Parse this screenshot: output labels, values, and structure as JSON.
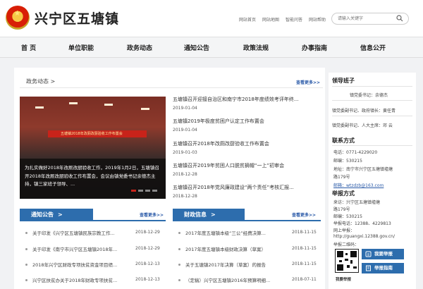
{
  "header": {
    "site_title": "兴宁区五塘镇",
    "top_links": [
      "网站首页",
      "网站地图",
      "智能问答",
      "网站帮助"
    ],
    "search_placeholder": "请输入关键字",
    "emblem_icon": "national-emblem-icon"
  },
  "nav": {
    "items": [
      "首 页",
      "单位职能",
      "政务动态",
      "通知公告",
      "政策法规",
      "办事指南",
      "信息公开"
    ]
  },
  "news": {
    "section_title": "政务动态 >",
    "more": "查看更多>>",
    "slider": {
      "banner_text": "五塘镇2018年改厕改厨验收工作布置会",
      "caption": "为扎实做好2018年改厕改厨验收工作，2019年1月2日，五塘镇召开2018年改厕改厨验收工作布置会，会议由镇党委书记余德杰主持，镇三家班子领导、...",
      "active_dot": 0,
      "dot_count": 4
    },
    "items": [
      {
        "title": "五塘镇召开迎接自治区和南宁市2018年度绩效考评年终...",
        "date": "2019-01-04"
      },
      {
        "title": "五塘镇2019年极度贫困户认定工作布置会",
        "date": "2019-01-04"
      },
      {
        "title": "五塘镇召开2018年改厕改厨验收工作布置会",
        "date": "2019-01-03"
      },
      {
        "title": "五塘镇召开2019年贫困人口脱贫摘帽“一上”初审会",
        "date": "2018-12-28"
      },
      {
        "title": "五塘镇召开2018年党风廉政建设“两个责任”考核汇报...",
        "date": "2018-12-28"
      }
    ]
  },
  "notice": {
    "title": "通知公告",
    "arrow": ">",
    "more": "查看更多>>",
    "items": [
      {
        "title": "关于印发《兴宁区五塘镇民族宗教工作...",
        "date": "2018-12-29"
      },
      {
        "title": "关于印发《南宁市兴宁区五塘镇2018年...",
        "date": "2018-12-29"
      },
      {
        "title": "2018年兴宁区财政专项扶贫资金项目绩...",
        "date": "2018-12-13"
      },
      {
        "title": "兴宁区扶贫办关于2018年财政专项扶贫...",
        "date": "2018-12-13"
      }
    ]
  },
  "finance": {
    "title": "财政信息",
    "arrow": ">",
    "more": "查看更多>>",
    "items": [
      {
        "title": "2017年度五塘镇本级“三公”经费决算...",
        "date": "2018-11-15"
      },
      {
        "title": "2017年度五塘镇本级财政决算（草案）",
        "date": "2018-11-15"
      },
      {
        "title": "关于五塘镇2017年决算（草案）的报告",
        "date": "2018-11-15"
      },
      {
        "title": "（定稿）兴宁区五塘镇2016年预算明细...",
        "date": "2018-07-11"
      }
    ]
  },
  "side": {
    "leaders_title": "领导班子",
    "leaders": [
      "镇党委书记：余德杰",
      "镇党委副书记、政府镇长：黄任青",
      "镇党委副书记、人大主席：邓 云"
    ],
    "contact_title": "联系方式",
    "contact": [
      "电话：0771-4229020",
      "邮编：530215",
      "地址：南宁市兴宁区五塘镇墟塘",
      "路179号",
      "邮箱：wtzdzb@163.com"
    ],
    "report_title": "举报方式",
    "report": [
      "来访：兴宁区五塘镇墟塘",
      "路179号",
      "邮编：530215",
      "举报电话：12388、4229813",
      "网上举报：",
      "http://guangxi.12388.gov.cn/",
      "举报二维码："
    ],
    "qr_caption": "我要举报",
    "buttons": [
      {
        "label": "我要举报",
        "icon": "report-icon"
      },
      {
        "label": "举报指南",
        "icon": "guide-icon"
      }
    ]
  }
}
